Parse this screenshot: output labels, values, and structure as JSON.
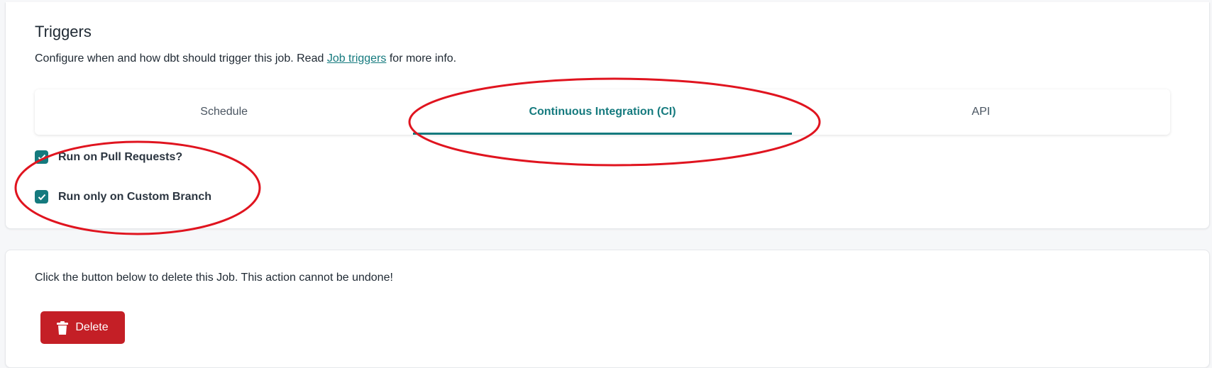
{
  "triggers": {
    "title": "Triggers",
    "description_prefix": "Configure when and how dbt should trigger this job. Read ",
    "description_link": "Job triggers",
    "description_suffix": " for more info.",
    "tabs": [
      {
        "label": "Schedule",
        "active": false
      },
      {
        "label": "Continuous Integration (CI)",
        "active": true
      },
      {
        "label": "API",
        "active": false
      }
    ],
    "options": [
      {
        "label": "Run on Pull Requests?",
        "checked": true
      },
      {
        "label": "Run only on Custom Branch",
        "checked": true
      }
    ]
  },
  "delete_section": {
    "text": "Click the button below to delete this Job. This action cannot be undone!",
    "button_label": "Delete",
    "button_icon": "trash-icon"
  },
  "colors": {
    "accent": "#157a7e",
    "danger": "#c41f26",
    "annotation": "#e0141f"
  }
}
